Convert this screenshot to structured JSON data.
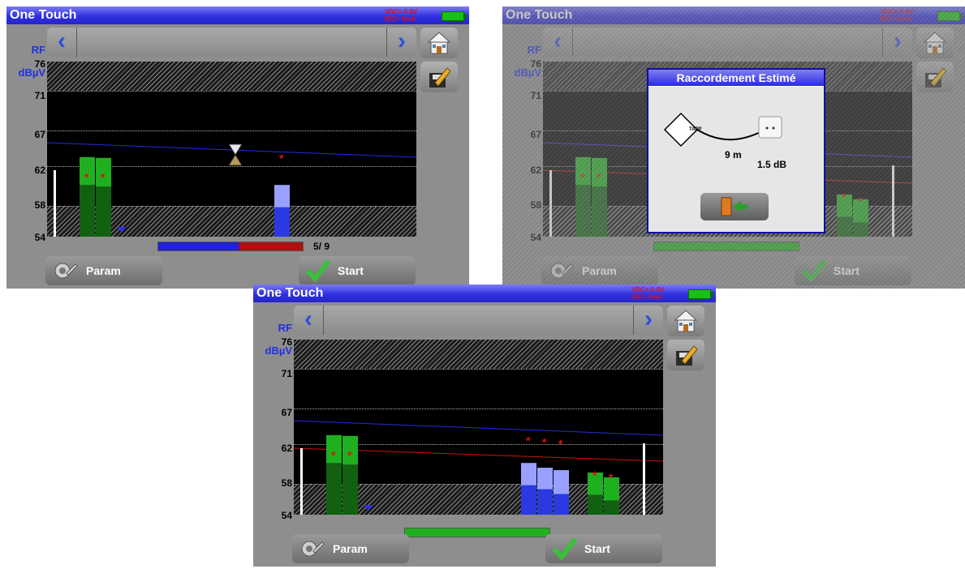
{
  "screens": [
    {
      "app_title": "One Touch",
      "vdc": "VDC= 0.0V",
      "idc": "IDC= 0mA",
      "y_axis": {
        "unit_top": "RF",
        "unit_bottom": "dBµV",
        "ticks": [
          "76",
          "71",
          "67",
          "62",
          "58",
          "54"
        ]
      },
      "progress_text": "5/ 9",
      "buttons": {
        "param": "Param",
        "start": "Start"
      }
    },
    {
      "app_title": "One Touch",
      "vdc": "VDC= 0.0V",
      "idc": "IDC= 0mA",
      "y_axis": {
        "unit_top": "RF",
        "unit_bottom": "dBµV",
        "ticks": [
          "76",
          "71",
          "67",
          "62",
          "58",
          "54"
        ]
      },
      "dialog": {
        "title": "Raccordement Estimé",
        "device": "TAPP",
        "distance": "9 m",
        "loss": "1.5 dB"
      },
      "buttons": {
        "param": "Param",
        "start": "Start"
      }
    },
    {
      "app_title": "One Touch",
      "vdc": "VDC= 0.0V",
      "idc": "IDC= 0mA",
      "y_axis": {
        "unit_top": "RF",
        "unit_bottom": "dBµV",
        "ticks": [
          "76",
          "71",
          "67",
          "62",
          "58",
          "54"
        ]
      },
      "buttons": {
        "param": "Param",
        "start": "Start"
      }
    }
  ],
  "chart_data": [
    {
      "type": "bar",
      "y_unit": "dBµV",
      "ylim": [
        54,
        76
      ],
      "bars": [
        {
          "color": "#1fb01f",
          "value": 64.0,
          "lower": 60.5,
          "star": 61.8
        },
        {
          "color": "#1fb01f",
          "value": 63.9,
          "lower": 60.3,
          "star": 61.8
        },
        {
          "color": "#9aa0ff",
          "value": 60.5,
          "lower": 57.7
        }
      ],
      "pointer_star": 63.2,
      "progress": 0.555
    },
    {
      "type": "bar",
      "y_unit": "dBµV",
      "ylim": [
        54,
        76
      ],
      "bars": [
        {
          "color": "#1fb01f",
          "value": 64.0,
          "lower": 60.5,
          "star": 61.8
        },
        {
          "color": "#1fb01f",
          "value": 63.9,
          "lower": 60.3,
          "star": 61.8
        },
        {
          "color": "#1fb01f",
          "value": 59.3,
          "lower": 56.5,
          "star": 59.3
        },
        {
          "color": "#1fb01f",
          "value": 58.7,
          "lower": 55.8,
          "star": 58.8
        }
      ],
      "progress": 1.0
    },
    {
      "type": "bar",
      "y_unit": "dBµV",
      "ylim": [
        54,
        76
      ],
      "bars": [
        {
          "color": "#1fb01f",
          "value": 64.0,
          "lower": 60.5,
          "star": 61.8
        },
        {
          "color": "#1fb01f",
          "value": 63.9,
          "lower": 60.3,
          "star": 61.8
        },
        {
          "color": "#9aa0ff",
          "value": 60.5,
          "lower": 57.7,
          "star": 63.6
        },
        {
          "color": "#9aa0ff",
          "value": 59.9,
          "lower": 57.2,
          "star": 63.4
        },
        {
          "color": "#9aa0ff",
          "value": 59.6,
          "lower": 56.6,
          "star": 63.2
        },
        {
          "color": "#1fb01f",
          "value": 59.3,
          "lower": 56.5,
          "star": 59.3
        },
        {
          "color": "#1fb01f",
          "value": 58.7,
          "lower": 55.8,
          "star": 59.0
        }
      ],
      "progress": 1.0
    }
  ]
}
